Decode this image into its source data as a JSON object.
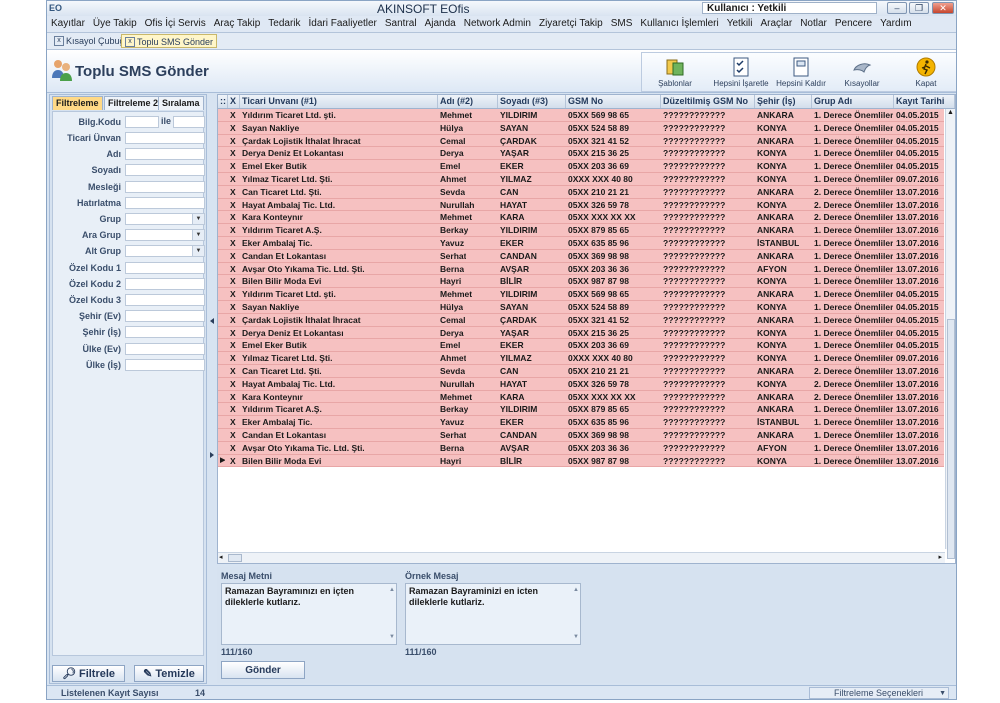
{
  "window": {
    "title": "AKINSOFT EOfis",
    "app_icon": "EO",
    "user_label": "Kullanıcı : Yetkili"
  },
  "menu": [
    "Kayıtlar",
    "Üye Takip",
    "Ofis İçi Servis",
    "Araç Takip",
    "Tedarik",
    "İdari Faaliyetler",
    "Santral",
    "Ajanda",
    "Network Admin",
    "Ziyaretçi Takip",
    "SMS",
    "Kullanıcı İşlemleri",
    "Yetkili",
    "Araçlar",
    "Notlar",
    "Pencere",
    "Yardım"
  ],
  "doc_tabs": [
    {
      "label": "Kısayol Çubuğu",
      "active": false
    },
    {
      "label": "Toplu SMS Gönder",
      "active": true
    }
  ],
  "page_title": "Toplu SMS Gönder",
  "toolbar": [
    {
      "label": "Şablonlar",
      "icon": "templates-icon"
    },
    {
      "label": "Hepsini İşaretle",
      "icon": "check-all-icon"
    },
    {
      "label": "Hepsini Kaldır",
      "icon": "uncheck-all-icon"
    },
    {
      "label": "Kısayollar",
      "icon": "shortcuts-icon"
    },
    {
      "label": "Kapat",
      "icon": "close-run-icon"
    }
  ],
  "filter_tabs": [
    {
      "label": "Filtreleme",
      "active": true
    },
    {
      "label": "Filtreleme 2",
      "active": false
    },
    {
      "label": "Sıralama",
      "active": false
    }
  ],
  "filters": {
    "bilg_kodu": {
      "label": "Bilg.Kodu",
      "connector": "ile"
    },
    "fields": [
      {
        "label": "Ticari Ünvan",
        "combo": false
      },
      {
        "label": "Adı",
        "combo": false
      },
      {
        "label": "Soyadı",
        "combo": false
      },
      {
        "label": "Mesleği",
        "combo": false
      },
      {
        "label": "Hatırlatma",
        "combo": false
      },
      {
        "label": "Grup",
        "combo": true
      },
      {
        "label": "Ara Grup",
        "combo": true
      },
      {
        "label": "Alt Grup",
        "combo": true
      },
      {
        "label": "Özel Kodu 1",
        "combo": false
      },
      {
        "label": "Özel Kodu 2",
        "combo": false
      },
      {
        "label": "Özel Kodu 3",
        "combo": false
      },
      {
        "label": "Şehir (Ev)",
        "combo": false
      },
      {
        "label": "Şehir (İş)",
        "combo": false
      },
      {
        "label": "Ülke (Ev)",
        "combo": false
      },
      {
        "label": "Ülke (İş)",
        "combo": false
      }
    ]
  },
  "buttons": {
    "filter": "Filtrele",
    "clear": "Temizle",
    "send": "Gönder"
  },
  "grid": {
    "columns": [
      ":: ",
      "X",
      "Ticari Unvanı (#1)",
      "Adı (#2)",
      "Soyadı (#3)",
      "GSM No",
      "Düzeltilmiş GSM No",
      "Şehir (İş)",
      "Grup Adı",
      "Kayıt Tarihi"
    ],
    "rows": [
      [
        "X",
        "Yıldırım Ticaret Ltd. şti.",
        "Mehmet",
        "YILDIRIM",
        "05XX 569 98 65",
        "????????????",
        "ANKARA",
        "1. Derece Önemliler",
        "04.05.2015"
      ],
      [
        "X",
        "Sayan Nakliye",
        "Hülya",
        "SAYAN",
        "05XX 524 58 89",
        "????????????",
        "KONYA",
        "1. Derece Önemliler",
        "04.05.2015"
      ],
      [
        "X",
        "Çardak Lojistik İthalat İhracat",
        "Cemal",
        "ÇARDAK",
        "05XX 321 41 52",
        "????????????",
        "ANKARA",
        "1. Derece Önemliler",
        "04.05.2015"
      ],
      [
        "X",
        "Derya Deniz Et Lokantası",
        "Derya",
        "YAŞAR",
        "05XX 215 36 25",
        "????????????",
        "KONYA",
        "1. Derece Önemliler",
        "04.05.2015"
      ],
      [
        "X",
        "Emel Eker Butik",
        "Emel",
        "EKER",
        "05XX 203 36 69",
        "????????????",
        "KONYA",
        "1. Derece Önemliler",
        "04.05.2015"
      ],
      [
        "X",
        "Yılmaz Ticaret Ltd. Şti.",
        "Ahmet",
        "YILMAZ",
        "0XXX XXX 40 80",
        "????????????",
        "KONYA",
        "1. Derece Önemliler",
        "09.07.2016"
      ],
      [
        "X",
        "Can Ticaret Ltd. Şti.",
        "Sevda",
        "CAN",
        "05XX 210 21 21",
        "????????????",
        "ANKARA",
        "2. Derece Önemliler",
        "13.07.2016"
      ],
      [
        "X",
        "Hayat Ambalaj Tic. Ltd.",
        "Nurullah",
        "HAYAT",
        "05XX 326 59 78",
        "????????????",
        "KONYA",
        "2. Derece Önemliler",
        "13.07.2016"
      ],
      [
        "X",
        "Kara Konteynır",
        "Mehmet",
        "KARA",
        "05XX XXX XX XX",
        "????????????",
        "ANKARA",
        "2. Derece Önemliler",
        "13.07.2016"
      ],
      [
        "X",
        "Yıldırım Ticaret A.Ş.",
        "Berkay",
        "YILDIRIM",
        "05XX 879 85 65",
        "????????????",
        "ANKARA",
        "1. Derece Önemliler",
        "13.07.2016"
      ],
      [
        "X",
        "Eker Ambalaj Tic.",
        "Yavuz",
        "EKER",
        "05XX 635 85 96",
        "????????????",
        "İSTANBUL",
        "1. Derece Önemliler",
        "13.07.2016"
      ],
      [
        "X",
        "Candan Et Lokantası",
        "Serhat",
        "CANDAN",
        "05XX 369 98 98",
        "????????????",
        "ANKARA",
        "1. Derece Önemliler",
        "13.07.2016"
      ],
      [
        "X",
        "Avşar Oto Yıkama Tic. Ltd. Şti.",
        "Berna",
        "AVŞAR",
        "05XX 203 36 36",
        "????????????",
        "AFYON",
        "1. Derece Önemliler",
        "13.07.2016"
      ],
      [
        "X",
        "Bilen Bilir Moda Evi",
        "Hayri",
        "BİLİR",
        "05XX 987 87 98",
        "????????????",
        "KONYA",
        "1. Derece Önemliler",
        "13.07.2016"
      ],
      [
        "X",
        "Yıldırım Ticaret Ltd. şti.",
        "Mehmet",
        "YILDIRIM",
        "05XX 569 98 65",
        "????????????",
        "ANKARA",
        "1. Derece Önemliler",
        "04.05.2015"
      ],
      [
        "X",
        "Sayan Nakliye",
        "Hülya",
        "SAYAN",
        "05XX 524 58 89",
        "????????????",
        "KONYA",
        "1. Derece Önemliler",
        "04.05.2015"
      ],
      [
        "X",
        "Çardak Lojistik İthalat İhracat",
        "Cemal",
        "ÇARDAK",
        "05XX 321 41 52",
        "????????????",
        "ANKARA",
        "1. Derece Önemliler",
        "04.05.2015"
      ],
      [
        "X",
        "Derya Deniz Et Lokantası",
        "Derya",
        "YAŞAR",
        "05XX 215 36 25",
        "????????????",
        "KONYA",
        "1. Derece Önemliler",
        "04.05.2015"
      ],
      [
        "X",
        "Emel Eker Butik",
        "Emel",
        "EKER",
        "05XX 203 36 69",
        "????????????",
        "KONYA",
        "1. Derece Önemliler",
        "04.05.2015"
      ],
      [
        "X",
        "Yılmaz Ticaret Ltd. Şti.",
        "Ahmet",
        "YILMAZ",
        "0XXX XXX 40 80",
        "????????????",
        "KONYA",
        "1. Derece Önemliler",
        "09.07.2016"
      ],
      [
        "X",
        "Can Ticaret Ltd. Şti.",
        "Sevda",
        "CAN",
        "05XX 210 21 21",
        "????????????",
        "ANKARA",
        "2. Derece Önemliler",
        "13.07.2016"
      ],
      [
        "X",
        "Hayat Ambalaj Tic. Ltd.",
        "Nurullah",
        "HAYAT",
        "05XX 326 59 78",
        "????????????",
        "KONYA",
        "2. Derece Önemliler",
        "13.07.2016"
      ],
      [
        "X",
        "Kara Konteynır",
        "Mehmet",
        "KARA",
        "05XX XXX XX XX",
        "????????????",
        "ANKARA",
        "2. Derece Önemliler",
        "13.07.2016"
      ],
      [
        "X",
        "Yıldırım Ticaret A.Ş.",
        "Berkay",
        "YILDIRIM",
        "05XX 879 85 65",
        "????????????",
        "ANKARA",
        "1. Derece Önemliler",
        "13.07.2016"
      ],
      [
        "X",
        "Eker Ambalaj Tic.",
        "Yavuz",
        "EKER",
        "05XX 635 85 96",
        "????????????",
        "İSTANBUL",
        "1. Derece Önemliler",
        "13.07.2016"
      ],
      [
        "X",
        "Candan Et Lokantası",
        "Serhat",
        "CANDAN",
        "05XX 369 98 98",
        "????????????",
        "ANKARA",
        "1. Derece Önemliler",
        "13.07.2016"
      ],
      [
        "X",
        "Avşar Oto Yıkama Tic. Ltd. Şti.",
        "Berna",
        "AVŞAR",
        "05XX 203 36 36",
        "????????????",
        "AFYON",
        "1. Derece Önemliler",
        "13.07.2016"
      ],
      [
        "X",
        "Bilen Bilir Moda Evi",
        "Hayri",
        "BİLİR",
        "05XX 987 87 98",
        "????????????",
        "KONYA",
        "1. Derece Önemliler",
        "13.07.2016"
      ]
    ],
    "row_color": "#f6c1c1",
    "current_row_marker": "▶"
  },
  "message": {
    "label": "Mesaj Metni",
    "text": "Ramazan Bayramınızı en içten dileklerle kutlarız.",
    "count": "111/160"
  },
  "sample": {
    "label": "Örnek Mesaj",
    "text": "Ramazan Bayraminizi en icten dileklerle kutlariz.",
    "count": "111/160"
  },
  "status": {
    "listed_label": "Listelenen Kayıt Sayısı",
    "listed_count": "14",
    "filter_options": "Filtreleme Seçenekleri"
  }
}
